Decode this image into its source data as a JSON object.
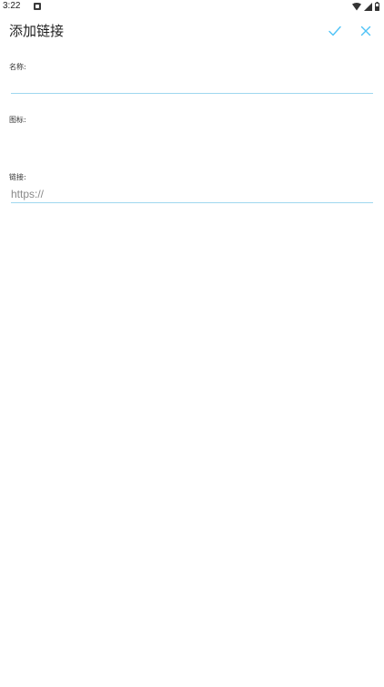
{
  "status_bar": {
    "time": "3:22"
  },
  "app_bar": {
    "title": "添加链接",
    "confirm_icon": "check-icon",
    "close_icon": "close-icon"
  },
  "form": {
    "name": {
      "label": "名称:",
      "value": "",
      "placeholder": ""
    },
    "icon": {
      "label": "图标:"
    },
    "link": {
      "label": "链接:",
      "value": "",
      "placeholder": "https://"
    }
  },
  "colors": {
    "accent": "#4fc3f7",
    "underline": "#9fd7ef",
    "background": "#ffffff"
  }
}
